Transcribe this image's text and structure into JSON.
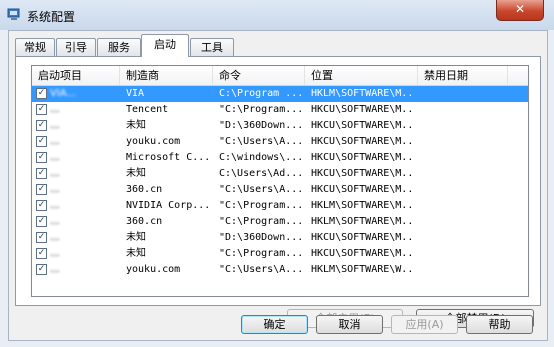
{
  "window": {
    "title": "系统配置",
    "close_label": "✕"
  },
  "tabs": [
    {
      "label": "常规"
    },
    {
      "label": "引导"
    },
    {
      "label": "服务"
    },
    {
      "label": "启动"
    },
    {
      "label": "工具"
    }
  ],
  "startup_table": {
    "columns": [
      "启动项目",
      "制造商",
      "命令",
      "位置",
      "禁用日期"
    ],
    "rows": [
      {
        "name": "VIA...",
        "maker": "VIA",
        "command": "C:\\Program ...",
        "location": "HKLM\\SOFTWARE\\M...",
        "checked": true,
        "selected": true
      },
      {
        "name": "...",
        "maker": "Tencent",
        "command": "\"C:\\Program...",
        "location": "HKCU\\SOFTWARE\\M...",
        "checked": true,
        "selected": false
      },
      {
        "name": "...",
        "maker": "未知",
        "command": "\"D:\\360Down...",
        "location": "HKCU\\SOFTWARE\\M...",
        "checked": true,
        "selected": false
      },
      {
        "name": "...",
        "maker": "youku.com",
        "command": "\"C:\\Users\\A...",
        "location": "HKCU\\SOFTWARE\\M...",
        "checked": true,
        "selected": false
      },
      {
        "name": "...",
        "maker": "Microsoft C...",
        "command": "C:\\windows\\...",
        "location": "HKCU\\SOFTWARE\\M...",
        "checked": true,
        "selected": false
      },
      {
        "name": "...",
        "maker": "未知",
        "command": "C:\\Users\\Ad...",
        "location": "HKCU\\SOFTWARE\\M...",
        "checked": true,
        "selected": false
      },
      {
        "name": "...",
        "maker": "360.cn",
        "command": "\"C:\\Users\\A...",
        "location": "HKCU\\SOFTWARE\\M...",
        "checked": true,
        "selected": false
      },
      {
        "name": "...",
        "maker": "NVIDIA Corp...",
        "command": "\"C:\\Program...",
        "location": "HKLM\\SOFTWARE\\M...",
        "checked": true,
        "selected": false
      },
      {
        "name": "...",
        "maker": "360.cn",
        "command": "\"C:\\Program...",
        "location": "HKLM\\SOFTWARE\\M...",
        "checked": true,
        "selected": false
      },
      {
        "name": "...",
        "maker": "未知",
        "command": "\"D:\\360Down...",
        "location": "HKCU\\SOFTWARE\\M...",
        "checked": true,
        "selected": false
      },
      {
        "name": "...",
        "maker": "未知",
        "command": "\"C:\\Program...",
        "location": "HKCU\\SOFTWARE\\M...",
        "checked": true,
        "selected": false
      },
      {
        "name": "...",
        "maker": "youku.com",
        "command": "\"C:\\Users\\A...",
        "location": "HKLM\\SOFTWARE\\W...",
        "checked": true,
        "selected": false
      }
    ]
  },
  "panel_buttons": {
    "enable_all": "全部启用(E)",
    "disable_all": "全部禁用(D)"
  },
  "dialog_buttons": {
    "ok": "确定",
    "cancel": "取消",
    "apply": "应用(A)",
    "help": "帮助"
  },
  "colors": {
    "selection": "#3399ff",
    "close": "#c9472c"
  }
}
